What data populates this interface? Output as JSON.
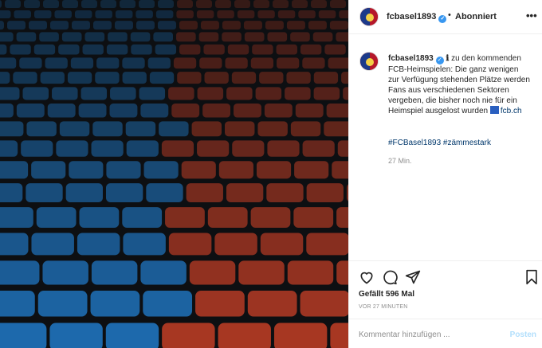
{
  "account": {
    "username": "fcbasel1893",
    "follow_status": "Abonniert",
    "separator": "•"
  },
  "caption": {
    "info_emoji": "ℹ",
    "text": "zu den kommenden FCB-Heimspielen: Die ganz wenigen zur Verfügung stehenden Plätze werden Fans aus verschiedenen Sektoren vergeben, die bisher noch nie für ein Heimspiel ausgelost wurden",
    "link": "fcb.ch",
    "hashtags": "#FCBasel1893 #zämmestark",
    "timestamp": "27 Min."
  },
  "engagement": {
    "likes": "Gefällt 596 Mal",
    "time_ago": "VOR 27 MINUTEN"
  },
  "comment": {
    "placeholder": "Kommentar hinzufügen ...",
    "post_label": "Posten"
  },
  "icons": {
    "more": "more-options-icon",
    "like": "heart-icon",
    "comment": "comment-icon",
    "share": "share-icon",
    "save": "bookmark-icon"
  },
  "colors": {
    "blue_seats": "#1f6fb5",
    "red_seats": "#b03a24",
    "brand_red": "#b5172a",
    "link": "#00376b"
  }
}
